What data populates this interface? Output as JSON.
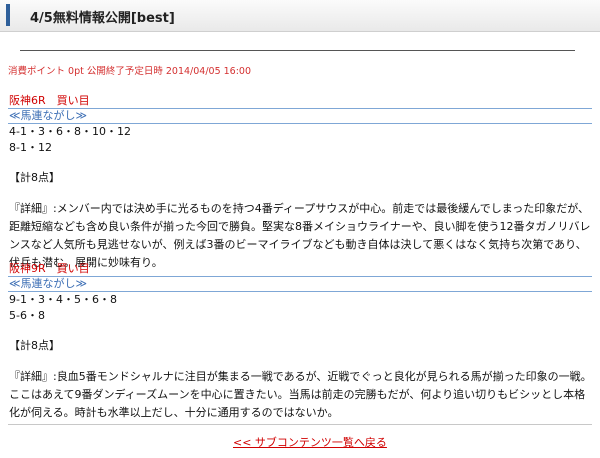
{
  "header": {
    "title": "4/5無料情報公開[best]"
  },
  "meta": {
    "text": "消費ポイント 0pt 公開終了予定日時  2014/04/05 16:00"
  },
  "races": [
    {
      "heading": "阪神6R　買い目",
      "bet_type": "≪馬連ながし≫",
      "lines": [
        "4-1・3・6・8・10・12",
        "8-1・12"
      ],
      "points": "【計8点】",
      "detail": "『詳細』:メンバー内では決め手に光るものを持つ4番ディープサウスが中心。前走では最後緩んでしまった印象だが、距離短縮なども含め良い条件が揃った今回で勝負。堅実な8番メイショウライナーや、良い脚を使う12番タガノリバレンスなど人気所も見逃せないが、例えば3番のビーマイライブなども動き自体は決して悪くはなく気持ち次第であり、伏兵も潜む。展開に妙味有り。"
    },
    {
      "heading": "阪神9R　買い目",
      "bet_type": "≪馬連ながし≫",
      "lines": [
        "9-1・3・4・5・6・8",
        "5-6・8"
      ],
      "points": "【計8点】",
      "detail": "『詳細』:良血5番モンドシャルナに注目が集まる一戦であるが、近戦でぐっと良化が見られる馬が揃った印象の一戦。ここはあえて9番ダンディーズムーンを中心に置きたい。当馬は前走の完勝もだが、何より追い切りもビシッとし本格化が伺える。時計も水準以上だし、十分に通用するのではないか。"
    }
  ],
  "footer": {
    "back_link": "<< サブコンテンツ一覧へ戻る"
  }
}
